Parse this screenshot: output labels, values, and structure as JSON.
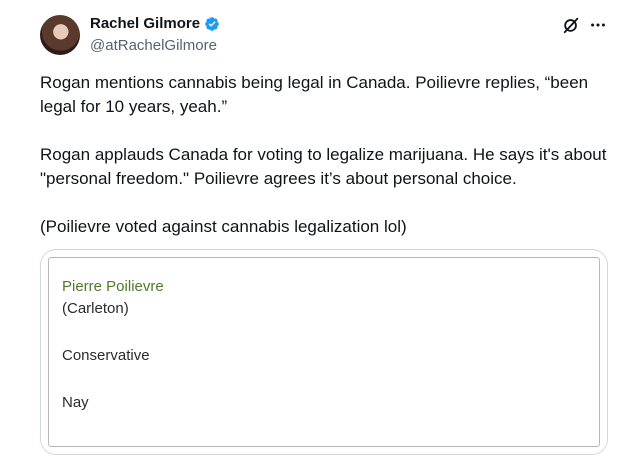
{
  "author": {
    "name": "Rachel Gilmore",
    "handle": "@atRachelGilmore"
  },
  "icons": {
    "verified": "verified-badge-icon",
    "grok": "grok-icon",
    "more": "more-options-icon"
  },
  "colors": {
    "verified": "#1d9bf0",
    "text": "#0f1419",
    "secondary_text": "#536471",
    "member_link": "#4f7a2a"
  },
  "tweet": {
    "paragraphs": [
      "Rogan mentions cannabis being legal in Canada. Poilievre replies, “been legal for 10 years, yeah.”",
      "Rogan applauds Canada for voting to legalize marijuana. He says it's about \"personal freedom.\" Poilievre agrees it’s about personal choice.",
      "(Poilievre voted against cannabis legalization lol)"
    ]
  },
  "media": {
    "member_name": "Pierre Poilievre",
    "riding": "(Carleton)",
    "party": "Conservative",
    "vote": "Nay"
  }
}
